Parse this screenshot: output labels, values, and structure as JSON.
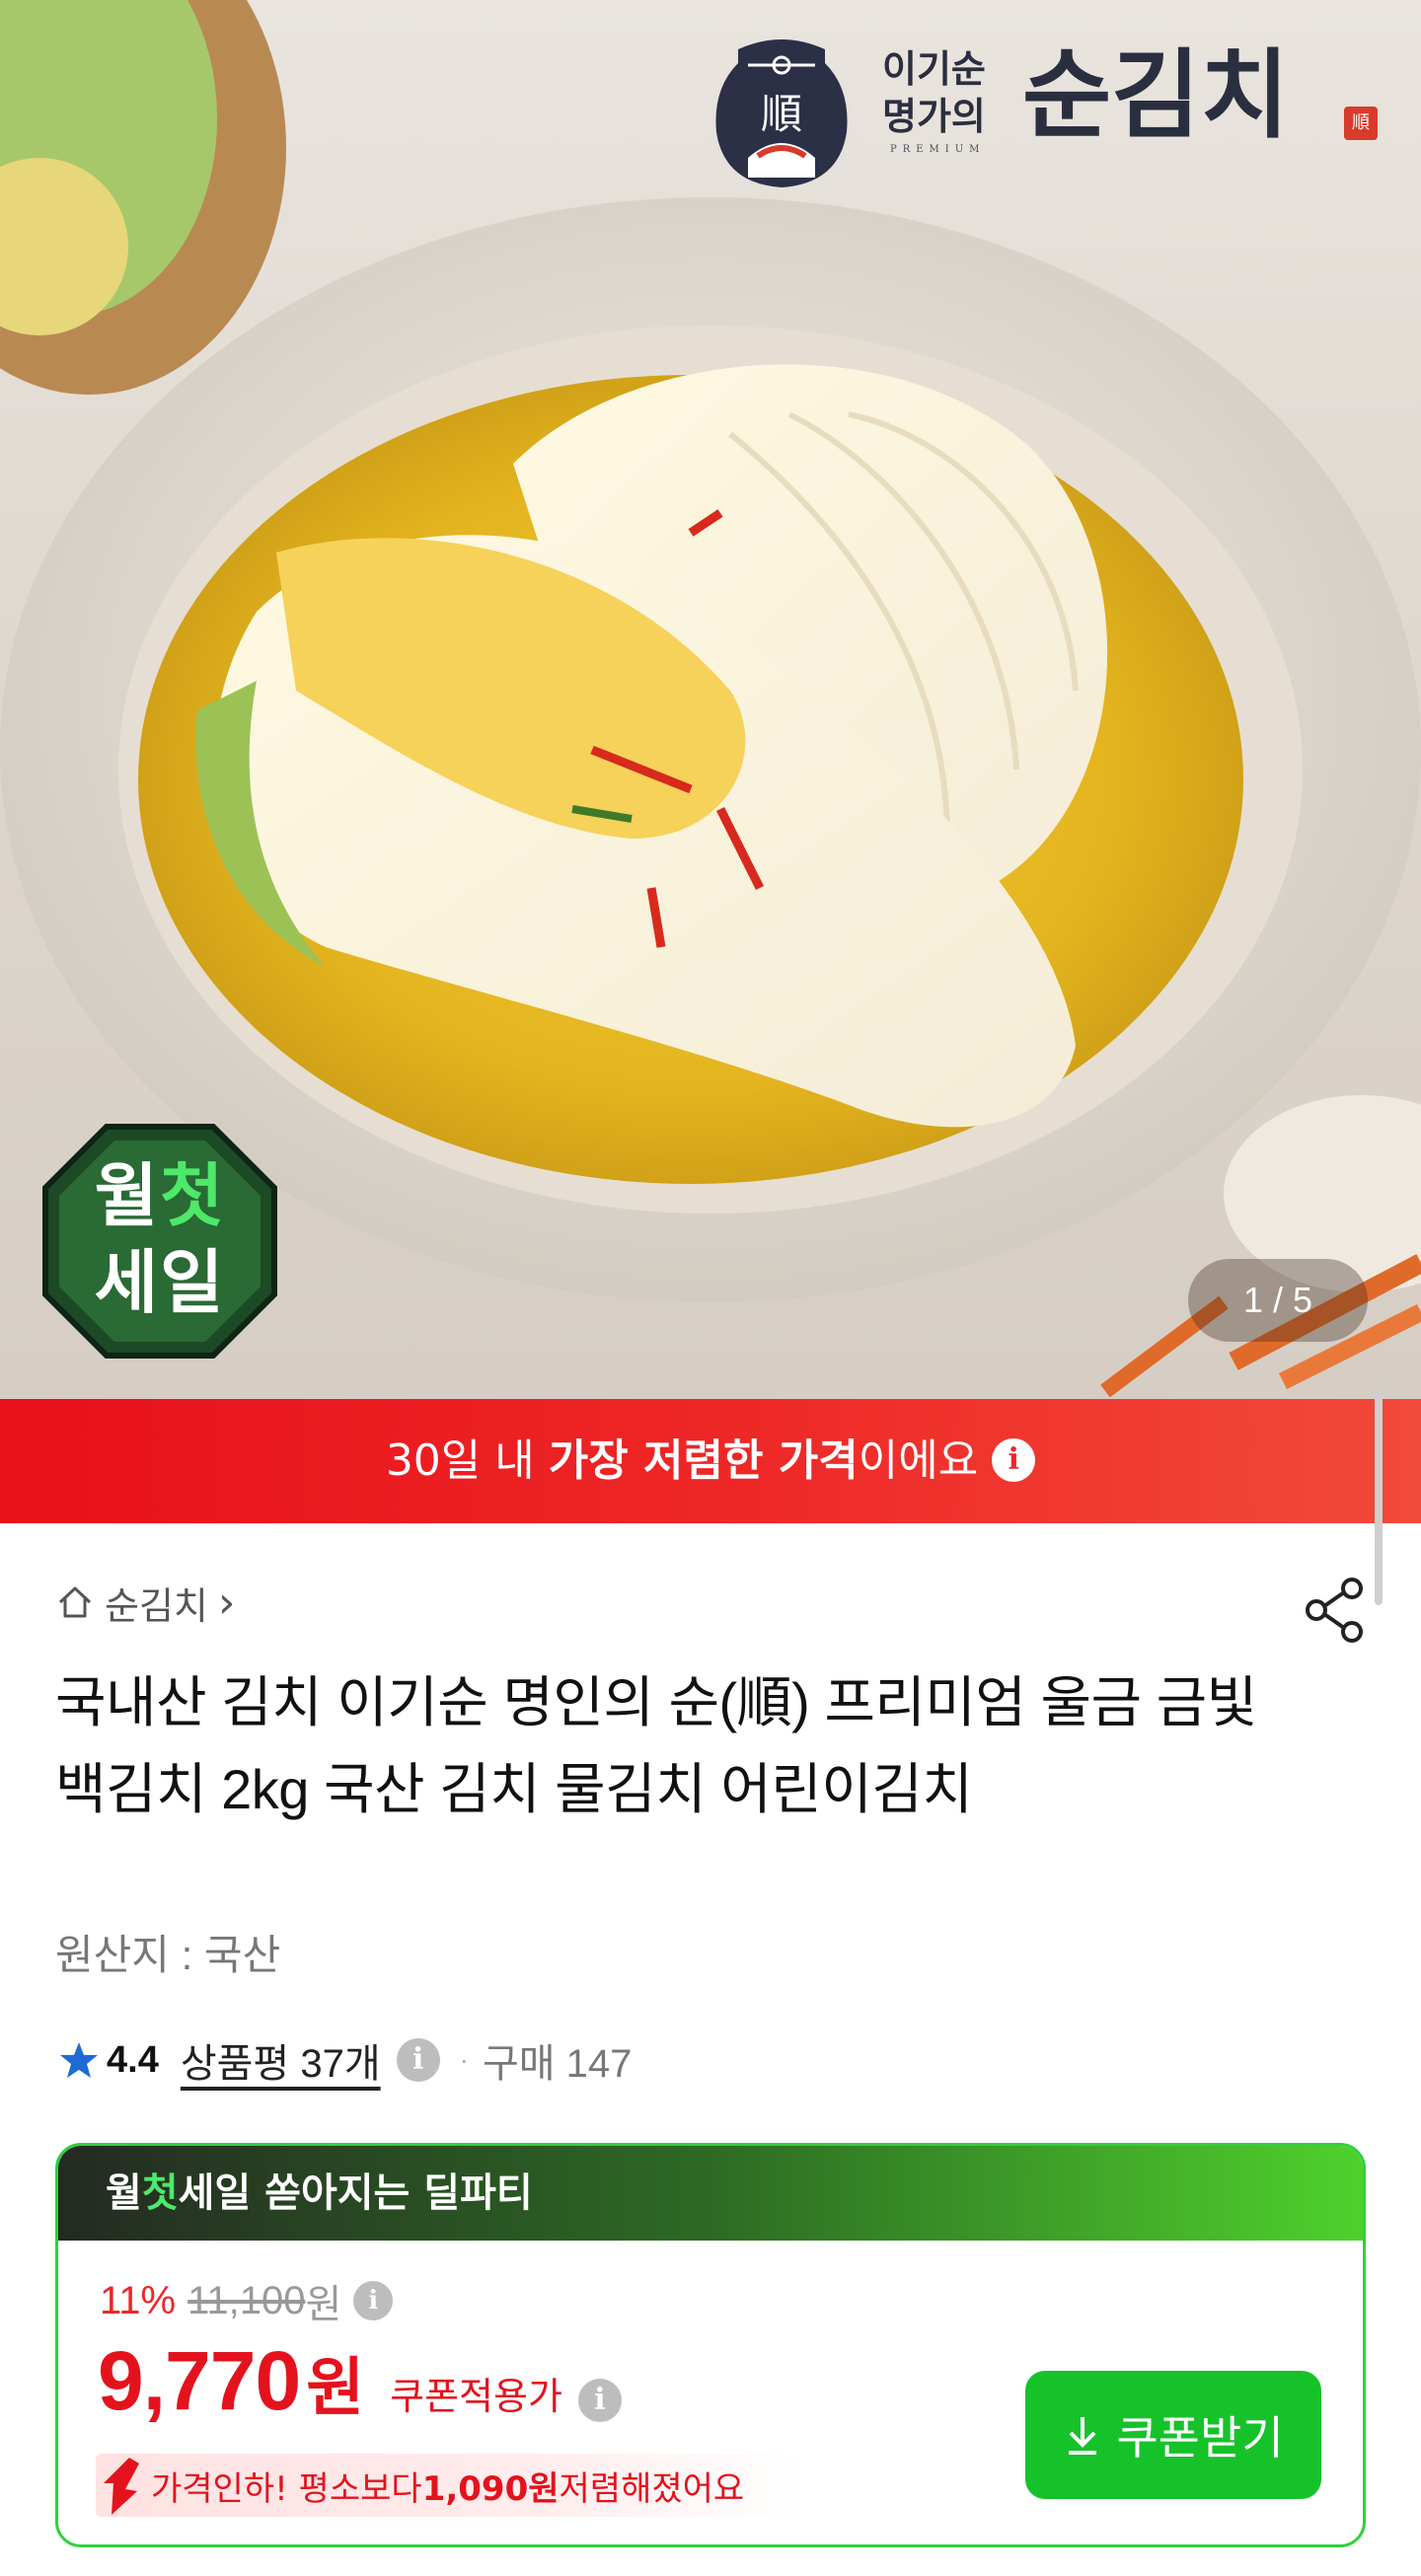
{
  "hero": {
    "brand_small_line1": "이기순",
    "brand_small_line2": "명가의",
    "brand_premium": "PREMIUM",
    "brand_name": "순김치",
    "brand_seal_char": "順",
    "brand_stamp_char": "順",
    "sale_badge_line1_a": "월",
    "sale_badge_line1_b": "첫",
    "sale_badge_line2": "세일",
    "page_counter": "1 / 5"
  },
  "banner": {
    "prefix": "30일 내 ",
    "bold": "가장 저렴한 가격",
    "suffix": "이에요",
    "info_icon": "i"
  },
  "product": {
    "breadcrumb_store": "순김치",
    "breadcrumb_chevron": "›",
    "title": "국내산 김치 이기순 명인의 순(順) 프리미엄 울금 금빛 백김치 2kg 국산 김치 물김치 어린이김치",
    "origin": "원산지 : 국산",
    "rating": "4.4",
    "reviews": "상품평 37개",
    "info_icon": "i",
    "separator": "·",
    "purchases": "구매 147"
  },
  "deal": {
    "header_a": "월",
    "header_b": "첫",
    "header_c": "세일",
    "header_suffix": " 쏟아지는 딜파티",
    "discount_pct": "11%",
    "original_price": "11,100",
    "original_won": "원",
    "final_price": "9,770",
    "final_won": "원",
    "coupon_label": "쿠폰적용가",
    "drop_prefix": "가격인하! 평소보다 ",
    "drop_amount": "1,090원",
    "drop_suffix": " 저렴해졌어요",
    "coupon_button": "쿠폰받기",
    "info_icon": "i"
  },
  "colors": {
    "accent_red": "#e4121c",
    "accent_green": "#16c22a",
    "banner_red": "#ee2626"
  }
}
